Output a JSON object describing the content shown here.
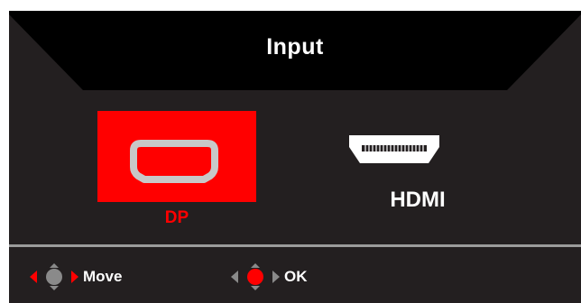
{
  "menu": {
    "title": "Input",
    "selected_index": 0,
    "options": [
      {
        "label": "DP",
        "icon": "displayport-icon",
        "selected": true
      },
      {
        "label": "HDMI",
        "icon": "hdmi-icon",
        "selected": false
      }
    ]
  },
  "footer": {
    "move_label": "Move",
    "move_icon": "left-right-arrows-icon",
    "ok_label": "OK",
    "ok_icon": "ok-button-icon"
  },
  "colors": {
    "panel_background": "#231f20",
    "header_background": "#000000",
    "accent": "#ff0000",
    "text": "#ffffff",
    "divider": "#9b9b9b"
  }
}
